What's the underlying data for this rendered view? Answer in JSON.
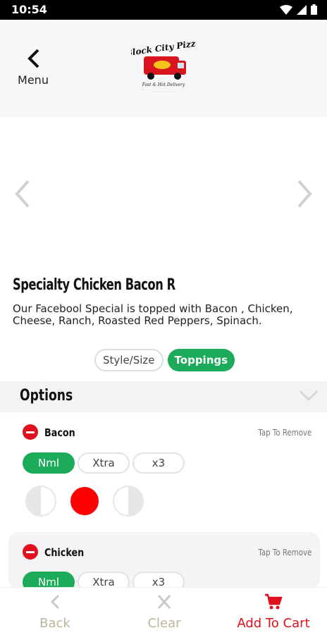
{
  "status": {
    "time": "10:54"
  },
  "header": {
    "back_label": "Menu",
    "logo_text": "Block City Pizza",
    "logo_sub": "Fast & Hot Delivery"
  },
  "product": {
    "title": "Specialty Chicken Bacon R",
    "description": "Our Facebool Special is topped with Bacon , Chicken, Cheese, Ranch, Roasted Red Peppers, Spinach."
  },
  "tabs": [
    {
      "label": "Style/Size"
    },
    {
      "label": "Toppings"
    }
  ],
  "options": {
    "label": "Options"
  },
  "toppings": [
    {
      "name": "Bacon",
      "tap_label": "Tap To Remove",
      "amounts": [
        "Nml",
        "Xtra",
        "x3"
      ],
      "selected_amount": "Nml",
      "portion": "whole"
    },
    {
      "name": "Chicken",
      "tap_label": "Tap To Remove",
      "amounts": [
        "Nml",
        "Xtra",
        "x3"
      ],
      "selected_amount": "Nml"
    }
  ],
  "bottom_bar": {
    "back": "Back",
    "clear": "Clear",
    "add_to_cart": "Add To Cart"
  },
  "colors": {
    "accent_green": "#1bab5b",
    "accent_red": "#e0101e"
  }
}
